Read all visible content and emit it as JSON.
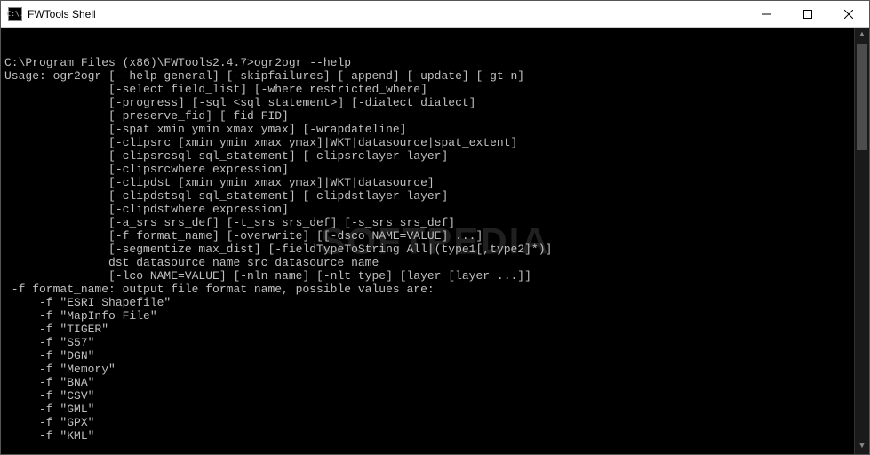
{
  "window": {
    "title": "FWTools Shell",
    "icon_label": "C:\\."
  },
  "terminal": {
    "prompt": "C:\\Program Files (x86)\\FWTools2.4.7>",
    "command": "ogr2ogr --help",
    "lines": [
      "C:\\Program Files (x86)\\FWTools2.4.7>ogr2ogr --help",
      "Usage: ogr2ogr [--help-general] [-skipfailures] [-append] [-update] [-gt n]",
      "               [-select field_list] [-where restricted_where]",
      "               [-progress] [-sql <sql statement>] [-dialect dialect]",
      "               [-preserve_fid] [-fid FID]",
      "               [-spat xmin ymin xmax ymax] [-wrapdateline]",
      "               [-clipsrc [xmin ymin xmax ymax]|WKT|datasource|spat_extent]",
      "               [-clipsrcsql sql_statement] [-clipsrclayer layer]",
      "               [-clipsrcwhere expression]",
      "               [-clipdst [xmin ymin xmax ymax]|WKT|datasource]",
      "               [-clipdstsql sql_statement] [-clipdstlayer layer]",
      "               [-clipdstwhere expression]",
      "               [-a_srs srs_def] [-t_srs srs_def] [-s_srs srs_def]",
      "               [-f format_name] [-overwrite] [[-dsco NAME=VALUE] ...]",
      "               [-segmentize max_dist] [-fieldTypeToString All|(type1[,type2]*)]",
      "               dst_datasource_name src_datasource_name",
      "               [-lco NAME=VALUE] [-nln name] [-nlt type] [layer [layer ...]]",
      "",
      " -f format_name: output file format name, possible values are:",
      "     -f \"ESRI Shapefile\"",
      "     -f \"MapInfo File\"",
      "     -f \"TIGER\"",
      "     -f \"S57\"",
      "     -f \"DGN\"",
      "     -f \"Memory\"",
      "     -f \"BNA\"",
      "     -f \"CSV\"",
      "     -f \"GML\"",
      "     -f \"GPX\"",
      "     -f \"KML\""
    ]
  },
  "watermark": "SOFTPEDIA"
}
